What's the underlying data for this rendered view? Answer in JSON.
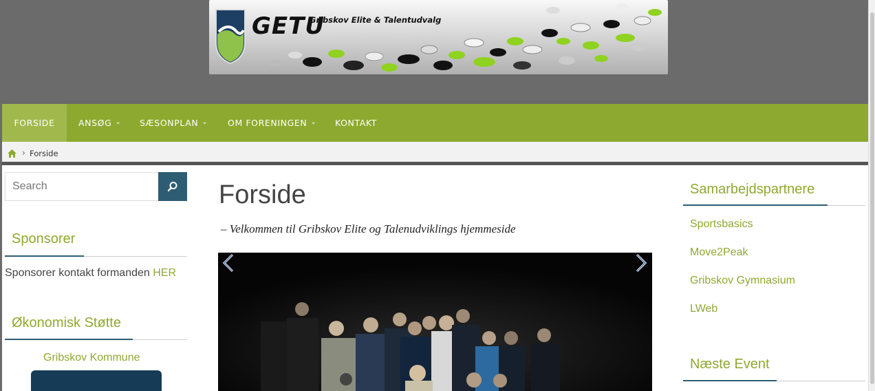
{
  "banner": {
    "logo_text": "GETU",
    "org_name": "Gribskov Elite & Talentudvalg"
  },
  "nav": {
    "items": [
      {
        "label": "FORSIDE",
        "active": true,
        "has_dropdown": false
      },
      {
        "label": "ANSØG",
        "active": false,
        "has_dropdown": true
      },
      {
        "label": "SÆSONPLAN",
        "active": false,
        "has_dropdown": true
      },
      {
        "label": "OM FORENINGEN",
        "active": false,
        "has_dropdown": true
      },
      {
        "label": "KONTAKT",
        "active": false,
        "has_dropdown": false
      }
    ],
    "dropdown_icon": "chevron-down-icon"
  },
  "breadcrumb": {
    "home_icon": "home-icon",
    "separator": "›",
    "current": "Forside"
  },
  "search": {
    "placeholder": "Search",
    "button_icon": "search-icon"
  },
  "left_sidebar": {
    "sponsors_title": "Sponsorer",
    "sponsors_text": "Sponsorer kontakt formanden",
    "sponsors_link": "HER",
    "support_title": "Økonomisk Støtte",
    "support_item": "Gribskov Kommune"
  },
  "main": {
    "title": "Forside",
    "welcome": "– Velkommen til Gribskov Elite og Talenudviklings hjemmeside",
    "slider_prev_icon": "chevron-left-icon",
    "slider_next_icon": "chevron-right-icon"
  },
  "right_sidebar": {
    "partners_title": "Samarbejdspartnere",
    "partners": [
      "Sportsbasics",
      "Move2Peak",
      "Gribskov Gymnasium",
      "LWeb"
    ],
    "event_title": "Næste Event"
  },
  "colors": {
    "header_bg": "#6b6b6b",
    "nav_bg": "#8ea92f",
    "accent_green": "#8ea92f",
    "accent_blue": "#2e5d73"
  }
}
